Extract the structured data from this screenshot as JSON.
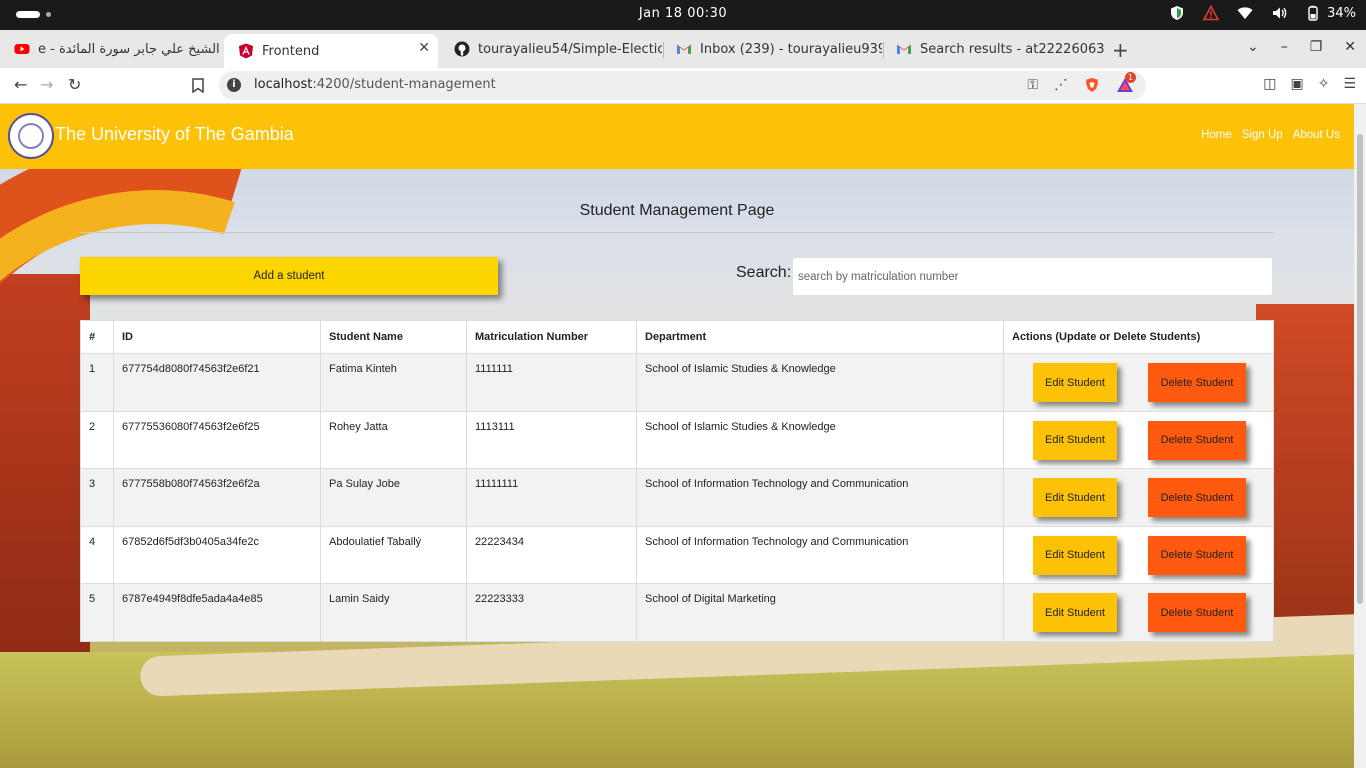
{
  "os": {
    "clock": "Jan 18  00:30",
    "battery": "34%"
  },
  "tabs": [
    {
      "title": "الشيخ علي جابر سورة المائدة - e",
      "icon": "youtube-icon"
    },
    {
      "title": "Frontend",
      "icon": "angular-icon",
      "active": true
    },
    {
      "title": "tourayalieu54/Simple-Electio",
      "icon": "github-icon"
    },
    {
      "title": "Inbox (239) - tourayalieu939",
      "icon": "gmail-icon"
    },
    {
      "title": "Search results - at22226063",
      "icon": "gmail-icon"
    }
  ],
  "address": {
    "host": "localhost",
    "path": ":4200/student-management"
  },
  "badge_count": "1",
  "navbar": {
    "brand": "The University of The Gambia",
    "links": [
      "Home",
      "Sign Up",
      "About Us"
    ]
  },
  "page": {
    "title": "Student Management Page",
    "add_button": "Add a student",
    "search_label": "Search:",
    "search_placeholder": "search by matriculation number",
    "search_value": ""
  },
  "table": {
    "headers": [
      "#",
      "ID",
      "Student Name",
      "Matriculation Number",
      "Department",
      "Actions (Update or Delete Students)"
    ],
    "edit_label": "Edit Student",
    "delete_label": "Delete Student",
    "rows": [
      {
        "num": "1",
        "id": "677754d8080f74563f2e6f21",
        "name": "Fatima Kinteh",
        "matric": "1111111",
        "dept": "School of Islamic Studies & Knowledge"
      },
      {
        "num": "2",
        "id": "67775536080f74563f2e6f25",
        "name": "Rohey Jatta",
        "matric": "1113111",
        "dept": "School of Islamic Studies & Knowledge"
      },
      {
        "num": "3",
        "id": "6777558b080f74563f2e6f2a",
        "name": "Pa Sulay Jobe",
        "matric": "11111111",
        "dept": "School of Information Technology and Communication"
      },
      {
        "num": "4",
        "id": "67852d6f5df3b0405a34fe2c",
        "name": "Abdoulatief Taballý",
        "matric": "22223434",
        "dept": "School of Information Technology and Communication"
      },
      {
        "num": "5",
        "id": "6787e4949f8dfe5ada4a4e85",
        "name": "Lamin Saidy",
        "matric": "22223333",
        "dept": "School of Digital Marketing"
      }
    ]
  },
  "colors": {
    "navbar": "#fdc208",
    "add_button": "#fdd600",
    "edit_button": "#fdc208",
    "delete_button": "#ff5a0f"
  }
}
